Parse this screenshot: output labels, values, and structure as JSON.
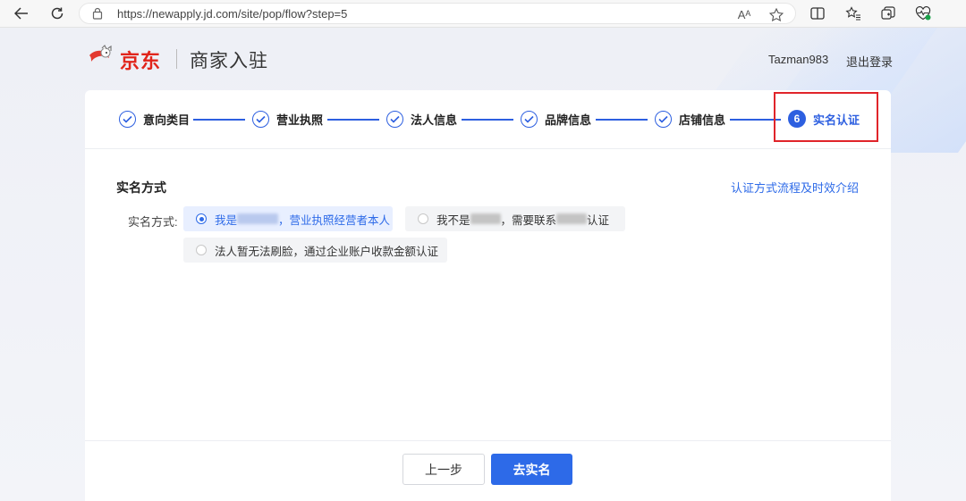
{
  "browser": {
    "url": "https://newapply.jd.com/site/pop/flow?step=5",
    "read_aloud_icon": "Aᴬ"
  },
  "header": {
    "logo_text": "京东",
    "title": "商家入驻",
    "username": "Tazman983",
    "logout": "退出登录"
  },
  "steps": [
    {
      "label": "意向类目",
      "status": "done"
    },
    {
      "label": "营业执照",
      "status": "done"
    },
    {
      "label": "法人信息",
      "status": "done"
    },
    {
      "label": "品牌信息",
      "status": "done"
    },
    {
      "label": "店铺信息",
      "status": "done"
    },
    {
      "number": "6",
      "label": "实名认证",
      "status": "active"
    }
  ],
  "section": {
    "title": "实名方式",
    "help_link": "认证方式流程及时效介绍",
    "field_label": "实名方式:"
  },
  "options": {
    "opt1_prefix": "我是",
    "opt1_suffix": "，营业执照经营者本人",
    "opt2_prefix": "我不是",
    "opt2_middle": "，需要联系",
    "opt2_suffix": "认证",
    "opt3": "法人暂无法刷脸，通过企业账户收款金额认证"
  },
  "footer": {
    "prev": "上一步",
    "next": "去实名"
  },
  "colors": {
    "primary": "#2d6ae8",
    "brand_red": "#e1251b",
    "highlight": "#e0242a"
  }
}
